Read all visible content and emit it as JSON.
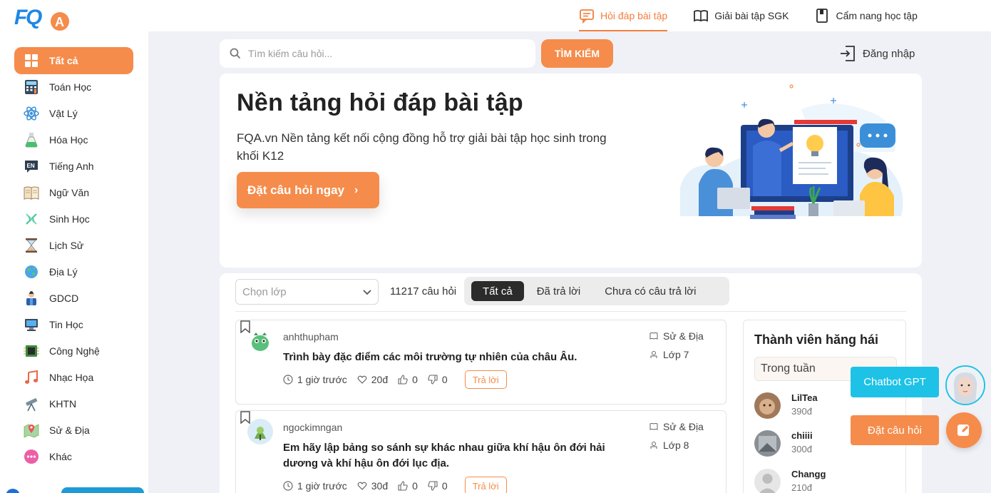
{
  "brand": {
    "logo_text": "FQA"
  },
  "topnav": {
    "items": [
      {
        "label": "Hỏi đáp bài tập",
        "icon": "chat-question-icon",
        "active": true
      },
      {
        "label": "Giải bài tập SGK",
        "icon": "open-book-icon",
        "active": false
      },
      {
        "label": "Cẩm nang học tập",
        "icon": "handbook-icon",
        "active": false
      }
    ]
  },
  "sidebar": {
    "items": [
      {
        "label": "Tất cả",
        "icon": "grid-icon",
        "active": true
      },
      {
        "label": "Toán Học",
        "icon": "calculator-icon"
      },
      {
        "label": "Vật Lý",
        "icon": "atom-icon"
      },
      {
        "label": "Hóa Học",
        "icon": "flask-icon"
      },
      {
        "label": "Tiếng Anh",
        "icon": "en-badge-icon"
      },
      {
        "label": "Ngữ Văn",
        "icon": "book-icon"
      },
      {
        "label": "Sinh Học",
        "icon": "dna-icon"
      },
      {
        "label": "Lịch Sử",
        "icon": "hourglass-icon"
      },
      {
        "label": "Địa Lý",
        "icon": "globe-icon"
      },
      {
        "label": "GDCD",
        "icon": "citizen-icon"
      },
      {
        "label": "Tin Học",
        "icon": "computer-icon"
      },
      {
        "label": "Công Nghệ",
        "icon": "chip-icon"
      },
      {
        "label": "Nhạc Họa",
        "icon": "music-note-icon"
      },
      {
        "label": "KHTN",
        "icon": "telescope-icon"
      },
      {
        "label": "Sử & Địa",
        "icon": "map-pin-icon"
      },
      {
        "label": "Khác",
        "icon": "more-dots-icon"
      }
    ]
  },
  "search": {
    "placeholder": "Tìm kiếm câu hỏi...",
    "button_label": "TÌM KIẾM"
  },
  "auth": {
    "login_label": "Đăng nhập"
  },
  "hero": {
    "title": "Nền tảng hỏi đáp bài tập",
    "description": "FQA.vn Nền tảng kết nối cộng đồng hỗ trợ giải bài tập học sinh trong khối K12",
    "cta_label": "Đặt câu hỏi ngay"
  },
  "filters": {
    "grade_placeholder": "Chọn lớp",
    "question_count": "11217 câu hỏi",
    "tabs": [
      {
        "label": "Tất cả",
        "active": true
      },
      {
        "label": "Đã trả lời",
        "active": false
      },
      {
        "label": "Chưa có câu trả lời",
        "active": false
      }
    ]
  },
  "questions": [
    {
      "user": "anhthupham",
      "text": "Trình bày đặc điểm các môi trường tự nhiên của châu Âu.",
      "time": "1 giờ trước",
      "points": "20đ",
      "likes": "0",
      "dislikes": "0",
      "reply_label": "Trả lời",
      "subject": "Sử & Địa",
      "grade": "Lớp 7"
    },
    {
      "user": "ngockimngan",
      "text": "Em hãy lập bảng so sánh sự khác nhau giữa khí hậu ôn đới hải dương và khí hậu ôn đới lục địa.",
      "time": "1 giờ trước",
      "points": "30đ",
      "likes": "0",
      "dislikes": "0",
      "reply_label": "Trả lời",
      "subject": "Sử & Địa",
      "grade": "Lớp 8"
    }
  ],
  "members": {
    "title": "Thành viên hăng hái",
    "period": "Trong tuần",
    "list": [
      {
        "name": "LilTea",
        "points": "390đ"
      },
      {
        "name": "chiiii",
        "points": "300đ"
      },
      {
        "name": "Changg",
        "points": "210đ"
      }
    ]
  },
  "floating": {
    "chatbot_label": "Chatbot GPT",
    "ask_label": "Đặt câu hỏi"
  },
  "colors": {
    "accent": "#f58c4b",
    "chatbot": "#1ec2e6",
    "dark_tab": "#2b2b2b"
  }
}
